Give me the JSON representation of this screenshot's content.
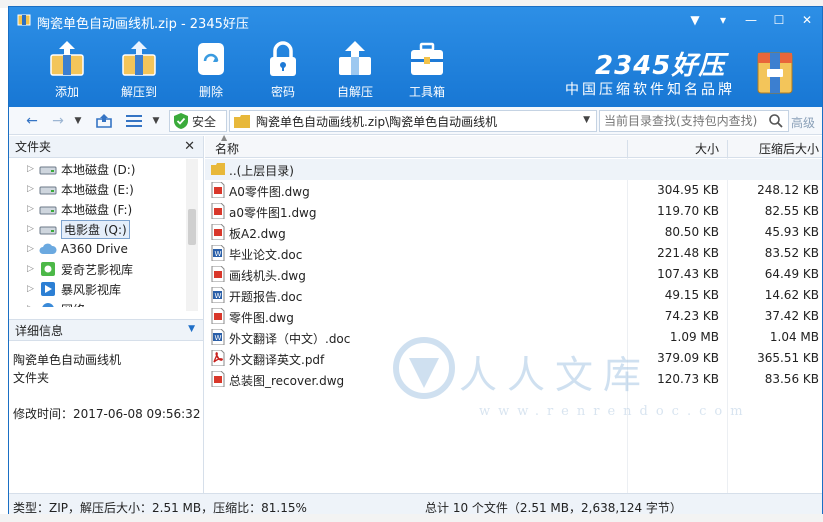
{
  "window": {
    "title": "陶瓷单色自动画线机.zip - 2345好压",
    "controls": [
      "▼",
      "▾",
      "—",
      "☐",
      "✕"
    ]
  },
  "toolbar": {
    "items": [
      {
        "label": "添加",
        "icon": "add-archive-icon"
      },
      {
        "label": "解压到",
        "icon": "extract-to-icon"
      },
      {
        "label": "删除",
        "icon": "delete-icon"
      },
      {
        "label": "密码",
        "icon": "password-lock-icon"
      },
      {
        "label": "自解压",
        "icon": "self-extract-icon"
      },
      {
        "label": "工具箱",
        "icon": "toolbox-icon"
      }
    ]
  },
  "brand": {
    "name": "2345好压",
    "slogan": "中国压缩软件知名品牌"
  },
  "nav": {
    "safe_label": "安全",
    "path": "陶瓷单色自动画线机.zip\\陶瓷单色自动画线机",
    "search_placeholder": "当前目录查找(支持包内查找)",
    "advanced_label": "高级"
  },
  "left_panel": {
    "files_header": "文件夹",
    "tree": [
      {
        "label": "本地磁盘 (D:)",
        "icon": "drive-icon"
      },
      {
        "label": "本地磁盘 (E:)",
        "icon": "drive-icon"
      },
      {
        "label": "本地磁盘 (F:)",
        "icon": "drive-icon"
      },
      {
        "label": "电影盘 (Q:)",
        "icon": "drive-icon",
        "selected": true
      },
      {
        "label": "A360 Drive",
        "icon": "cloud-drive-icon"
      },
      {
        "label": "爱奇艺影视库",
        "icon": "iqiyi-icon"
      },
      {
        "label": "暴风影视库",
        "icon": "baofeng-icon"
      },
      {
        "label": "网络",
        "icon": "network-icon"
      }
    ],
    "detail_header": "详细信息",
    "detail": {
      "name": "陶瓷单色自动画线机",
      "type": "文件夹",
      "modified": "修改时间：2017-06-08 09:56:32"
    }
  },
  "file_list": {
    "columns": {
      "name": "名称",
      "size": "大小",
      "compressed": "压缩后大小"
    },
    "parent_label": "..(上层目录)",
    "files": [
      {
        "name": "A0零件图.dwg",
        "size": "304.95 KB",
        "compressed": "248.12 KB",
        "type": "dwg"
      },
      {
        "name": "a0零件图1.dwg",
        "size": "119.70 KB",
        "compressed": "82.55 KB",
        "type": "dwg"
      },
      {
        "name": "板A2.dwg",
        "size": "80.50 KB",
        "compressed": "45.93 KB",
        "type": "dwg"
      },
      {
        "name": "毕业论文.doc",
        "size": "221.48 KB",
        "compressed": "83.52 KB",
        "type": "doc"
      },
      {
        "name": "画线机头.dwg",
        "size": "107.43 KB",
        "compressed": "64.49 KB",
        "type": "dwg"
      },
      {
        "name": "开题报告.doc",
        "size": "49.15 KB",
        "compressed": "14.62 KB",
        "type": "doc"
      },
      {
        "name": "零件图.dwg",
        "size": "74.23 KB",
        "compressed": "37.42 KB",
        "type": "dwg"
      },
      {
        "name": "外文翻译（中文）.doc",
        "size": "1.09 MB",
        "compressed": "1.04 MB",
        "type": "doc"
      },
      {
        "name": "外文翻译英文.pdf",
        "size": "379.09 KB",
        "compressed": "365.51 KB",
        "type": "pdf"
      },
      {
        "name": "总装图_recover.dwg",
        "size": "120.73 KB",
        "compressed": "83.56 KB",
        "type": "dwg"
      }
    ]
  },
  "watermark": {
    "text": "人人文库",
    "url": "www.renrendoc.com"
  },
  "status": {
    "left": "类型：ZIP，解压后大小：2.51 MB，压缩比：81.15%",
    "right": "总计 10 个文件（2.51 MB，2,638,124 字节）"
  },
  "colors": {
    "accent": "#1877d4",
    "header_top": "#2d8fe6",
    "dwg_red": "#d9372a",
    "doc_blue": "#2b5fa8",
    "pdf_red": "#c8201c",
    "folder_yellow": "#e8b83a"
  }
}
